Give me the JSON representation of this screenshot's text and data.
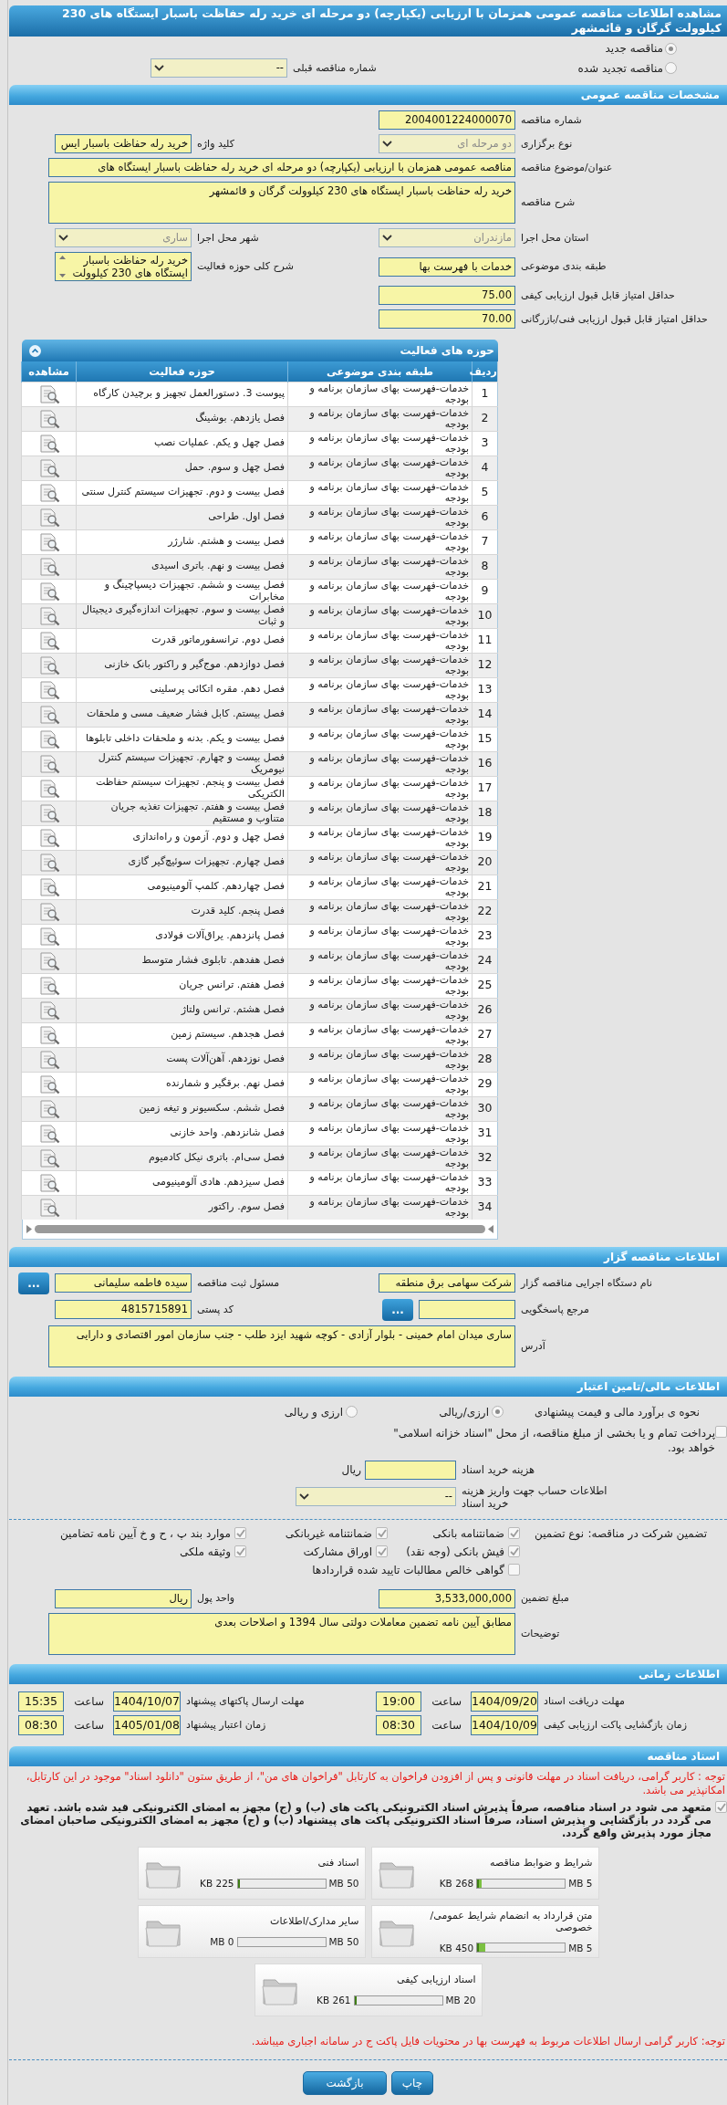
{
  "page_title": "مشاهده اطلاعات مناقصه عمومی همزمان با ارزیابی (یکپارچه) دو مرحله ای خرید رله حفاظت باسبار ایستگاه های 230 کیلوولت گرگان و قائمشهر",
  "tender_type": [
    {
      "label": "مناقصه جدید",
      "selected": true
    },
    {
      "label": "مناقصه تجدید شده",
      "selected": false
    }
  ],
  "previous_tender": {
    "label": "شماره مناقصه قبلی",
    "kind": "select",
    "value": "--",
    "disabled": false
  },
  "general": {
    "title": "مشخصات مناقصه عمومی",
    "rows": [
      [
        {
          "label": "شماره مناقصه",
          "kind": "text",
          "value": "2004001224000070"
        }
      ],
      [
        {
          "label": "نوع برگزاری",
          "kind": "select",
          "value": "دو مرحله ای",
          "disabled": true
        },
        {
          "label": "کلید واژه",
          "kind": "text",
          "value": "خرید رله حفاظت باسبار ایس"
        }
      ],
      [
        {
          "label": "عنوان/موضوع مناقصه",
          "kind": "longtext",
          "value": "مناقصه عمومی همزمان با ارزیابی (یکپارچه) دو مرحله ای خرید رله حفاظت باسبار ایستگاه های"
        }
      ],
      [
        {
          "label": "شرح مناقصه",
          "kind": "textarea",
          "value": "خرید رله حفاظت باسبار ایستگاه های 230 کیلوولت گرگان و قائمشهر"
        }
      ],
      [
        {
          "label": "استان محل اجرا",
          "kind": "select",
          "value": "مازندران",
          "disabled": true
        },
        {
          "label": "شهر محل اجرا",
          "kind": "select",
          "value": "ساری",
          "disabled": true
        }
      ],
      [
        {
          "label": "طبقه بندی موضوعی",
          "kind": "text",
          "value": "خدمات با فهرست بها"
        },
        {
          "label": "شرح کلی حوزه فعالیت",
          "kind": "listbox",
          "value": "خرید رله حفاظت باسبار ایستگاه های 230 کیلوولت"
        }
      ],
      [
        {
          "label": "حداقل امتیاز قابل قبول ارزیابی کیفی",
          "kind": "text",
          "value": "75.00"
        }
      ],
      [
        {
          "label": "حداقل امتیاز قابل قبول ارزیابی فنی/بازرگانی",
          "kind": "text",
          "value": "70.00"
        }
      ]
    ]
  },
  "activity": {
    "title": "حوزه های فعالیت",
    "columns": [
      "ردیف",
      "طبقه بندی موضوعی",
      "حوزه فعالیت",
      "مشاهده"
    ],
    "rows": [
      {
        "number": "1",
        "category": "خدمات-فهرست بهای سازمان برنامه و بودجه",
        "activity": "پیوست 3. دستورالعمل تجهیز و برچیدن کارگاه"
      },
      {
        "number": "2",
        "category": "خدمات-فهرست بهای سازمان برنامه و بودجه",
        "activity": "فصل یازدهم. بوشینگ"
      },
      {
        "number": "3",
        "category": "خدمات-فهرست بهای سازمان برنامه و بودجه",
        "activity": "فصل چهل و یکم. عملیات نصب"
      },
      {
        "number": "4",
        "category": "خدمات-فهرست بهای سازمان برنامه و بودجه",
        "activity": "فصل چهل و سوم. حمل"
      },
      {
        "number": "5",
        "category": "خدمات-فهرست بهای سازمان برنامه و بودجه",
        "activity": "فصل بیست و دوم. تجهیزات سیستم کنترل سنتی"
      },
      {
        "number": "6",
        "category": "خدمات-فهرست بهای سازمان برنامه و بودجه",
        "activity": "فصل اول. طراحی"
      },
      {
        "number": "7",
        "category": "خدمات-فهرست بهای سازمان برنامه و بودجه",
        "activity": "فصل بیست و هشتم. شارژر"
      },
      {
        "number": "8",
        "category": "خدمات-فهرست بهای سازمان برنامه و بودجه",
        "activity": "فصل بیست و نهم. باتری اسیدی"
      },
      {
        "number": "9",
        "category": "خدمات-فهرست بهای سازمان برنامه و بودجه",
        "activity": "فصل بیست و ششم. تجهیزات دیسپاچینگ و مخابرات"
      },
      {
        "number": "10",
        "category": "خدمات-فهرست بهای سازمان برنامه و بودجه",
        "activity": "فصل بیست و سوم. تجهیزات اندازه‌گیری دیجیتال و ثبات"
      },
      {
        "number": "11",
        "category": "خدمات-فهرست بهای سازمان برنامه و بودجه",
        "activity": "فصل دوم. ترانسفورماتور قدرت"
      },
      {
        "number": "12",
        "category": "خدمات-فهرست بهای سازمان برنامه و بودجه",
        "activity": "فصل دوازدهم. موج‌گیر و راکتور بانک خازنی"
      },
      {
        "number": "13",
        "category": "خدمات-فهرست بهای سازمان برنامه و بودجه",
        "activity": "فصل دهم. مقره اتکائی پرسلینی"
      },
      {
        "number": "14",
        "category": "خدمات-فهرست بهای سازمان برنامه و بودجه",
        "activity": "فصل بیستم. کابل فشار ضعیف مسی و ملحقات"
      },
      {
        "number": "15",
        "category": "خدمات-فهرست بهای سازمان برنامه و بودجه",
        "activity": "فصل بیست و یکم. بدنه و ملحقات داخلی تابلوها"
      },
      {
        "number": "16",
        "category": "خدمات-فهرست بهای سازمان برنامه و بودجه",
        "activity": "فصل بیست و چهارم. تجهیزات سیستم کنترل نیومریک"
      },
      {
        "number": "17",
        "category": "خدمات-فهرست بهای سازمان برنامه و بودجه",
        "activity": "فصل بیست و پنجم. تجهیزات سیستم حفاظت الکتریکی"
      },
      {
        "number": "18",
        "category": "خدمات-فهرست بهای سازمان برنامه و بودجه",
        "activity": "فصل بیست و هفتم. تجهیزات تغذیه جریان متناوب و مستقیم"
      },
      {
        "number": "19",
        "category": "خدمات-فهرست بهای سازمان برنامه و بودجه",
        "activity": "فصل چهل و دوم. آزمون و راه‌اندازی"
      },
      {
        "number": "20",
        "category": "خدمات-فهرست بهای سازمان برنامه و بودجه",
        "activity": "فصل چهارم. تجهیزات سوئیچ‌گیر گازی"
      },
      {
        "number": "21",
        "category": "خدمات-فهرست بهای سازمان برنامه و بودجه",
        "activity": "فصل چهاردهم. کلمپ آلومینیومی"
      },
      {
        "number": "22",
        "category": "خدمات-فهرست بهای سازمان برنامه و بودجه",
        "activity": "فصل پنجم. کلید قدرت"
      },
      {
        "number": "23",
        "category": "خدمات-فهرست بهای سازمان برنامه و بودجه",
        "activity": "فصل پانزدهم. یراق‌آلات فولادی"
      },
      {
        "number": "24",
        "category": "خدمات-فهرست بهای سازمان برنامه و بودجه",
        "activity": "فصل هفدهم. تابلوی فشار متوسط"
      },
      {
        "number": "25",
        "category": "خدمات-فهرست بهای سازمان برنامه و بودجه",
        "activity": "فصل هفتم. ترانس جریان"
      },
      {
        "number": "26",
        "category": "خدمات-فهرست بهای سازمان برنامه و بودجه",
        "activity": "فصل هشتم. ترانس ولتاژ"
      },
      {
        "number": "27",
        "category": "خدمات-فهرست بهای سازمان برنامه و بودجه",
        "activity": "فصل هجدهم. سیستم زمین"
      },
      {
        "number": "28",
        "category": "خدمات-فهرست بهای سازمان برنامه و بودجه",
        "activity": "فصل نوزدهم. آهن‌آلات پست"
      },
      {
        "number": "29",
        "category": "خدمات-فهرست بهای سازمان برنامه و بودجه",
        "activity": "فصل نهم. برقگیر و شمارنده"
      },
      {
        "number": "30",
        "category": "خدمات-فهرست بهای سازمان برنامه و بودجه",
        "activity": "فصل ششم. سکسیونر و تیغه زمین"
      },
      {
        "number": "31",
        "category": "خدمات-فهرست بهای سازمان برنامه و بودجه",
        "activity": "فصل شانزدهم. واحد خازنی"
      },
      {
        "number": "32",
        "category": "خدمات-فهرست بهای سازمان برنامه و بودجه",
        "activity": "فصل سی‌ام. باتری نیکل کادمیوم"
      },
      {
        "number": "33",
        "category": "خدمات-فهرست بهای سازمان برنامه و بودجه",
        "activity": "فصل سیزدهم. هادی آلومینیومی"
      },
      {
        "number": "34",
        "category": "خدمات-فهرست بهای سازمان برنامه و بودجه",
        "activity": "فصل سوم. راکتور"
      }
    ]
  },
  "organizer": {
    "title": "اطلاعات مناقصه گزار",
    "rows": [
      [
        {
          "label": "نام دستگاه اجرایی مناقصه گزار",
          "kind": "text",
          "value": "شرکت سهامی برق منطقه"
        },
        {
          "label": "مسئول ثبت مناقصه",
          "kind": "text",
          "value": "سیده فاطمه سلیمانی",
          "button": "..."
        }
      ],
      [
        {
          "label": "مرجع پاسخگویی",
          "kind": "text",
          "button": "..."
        },
        {
          "label": "کد پستی",
          "kind": "text",
          "value": "4815715891"
        }
      ],
      [
        {
          "label": "آدرس",
          "kind": "textarea",
          "value": "ساری میدان امام خمینی - بلوار آزادی - کوچه شهید ایزد طلب - جنب سازمان امور اقتصادی و دارایی"
        }
      ]
    ]
  },
  "financial": {
    "title": "اطلاعات مالی/تامین اعتبار",
    "estimate": {
      "label": "نحوه ی برآورد مالی و قیمت پیشنهادی",
      "options": [
        {
          "label": "ارزی/ریالی",
          "selected": true
        },
        {
          "label": "ارزی و ریالی",
          "selected": false
        }
      ]
    },
    "treasury": {
      "label": "پرداخت تمام و یا بخشی از مبلغ مناقصه، از محل \"اسناد خزانه اسلامی\" خواهد بود.",
      "checked": false
    },
    "doc_cost": {
      "label": "هزینه خرید اسناد",
      "kind": "text",
      "unit": "ریال"
    },
    "account": {
      "label": "اطلاعات حساب جهت واریز هزینه خرید اسناد",
      "kind": "select",
      "value": "--",
      "disabled": false
    },
    "guarantee": {
      "label": "تضمین شرکت در مناقصه:",
      "type_label": "نوع تضمین",
      "options": [
        {
          "label": "ضمانتنامه بانکی",
          "checked": true
        },
        {
          "label": "ضمانتنامه غیربانکی",
          "checked": true
        },
        {
          "label": "موارد بند پ ، ح و خ آیین نامه تضامین",
          "checked": true
        },
        {
          "label": "فیش بانکی (وجه نقد)",
          "checked": true
        },
        {
          "label": "اوراق مشارکت",
          "checked": true
        },
        {
          "label": "وثیقه ملکی",
          "checked": true
        },
        {
          "label": "گواهی خالص مطالبات تایید شده قراردادها",
          "checked": false
        }
      ]
    },
    "rows": [
      [
        {
          "label": "مبلغ تضمین",
          "kind": "text",
          "value": "3,533,000,000"
        },
        {
          "label": "واحد پول",
          "kind": "text",
          "value": "ریال"
        }
      ],
      [
        {
          "label": "توضیحات",
          "kind": "textarea",
          "value": "مطابق آیین نامه تضمین معاملات دولتی سال 1394 و اصلاحات بعدی"
        }
      ]
    ]
  },
  "timing": {
    "title": "اطلاعات زمانی",
    "items": [
      {
        "label": "مهلت دریافت اسناد",
        "date": "1404/09/20",
        "time_label": "ساعت",
        "time": "19:00"
      },
      {
        "label": "مهلت ارسال پاکتهای پیشنهاد",
        "date": "1404/10/07",
        "time_label": "ساعت",
        "time": "15:35"
      },
      {
        "label": "زمان بازگشایی پاکت ارزیابی کیفی",
        "date": "1404/10/09",
        "time_label": "ساعت",
        "time": "08:30"
      },
      {
        "label": "زمان اعتبار پیشنهاد",
        "date": "1405/01/08",
        "time_label": "ساعت",
        "time": "08:30"
      }
    ]
  },
  "documents": {
    "title": "اسناد مناقصه",
    "notice": "توجه : کاربر گرامی، دریافت اسناد در مهلت قانونی و پس از افزودن فراخوان به کارتابل \"فراخوان های من\"، از طریق ستون \"دانلود اسناد\" موجود در این کارتابل، امکانپذیر می باشد.",
    "commitment": {
      "text": "متعهد می شود در اسناد مناقصه، صرفاً پذیرش اسناد الکترونیکی پاکت های (ب) و (ج) مجهز به امضای الکترونیکی قید شده باشد. تعهد می گردد در بازگشایی و پذیرش اسناد، صرفاً اسناد الکترونیکی پاکت های پیشنهاد (ب) و (ج) مجهز به امضای الکترونیکی صاحبان امضای مجاز مورد پذیرش واقع گردد.",
      "checked": true
    },
    "files": [
      {
        "title": "شرایط و ضوابط مناقصه",
        "size": "268 KB",
        "max": "5 MB",
        "level": 0.05
      },
      {
        "title": "اسناد فنی",
        "size": "225 KB",
        "max": "50 MB",
        "level": 0.02
      },
      {
        "title": "متن قرارداد به انضمام شرایط عمومی/خصوصی",
        "size": "450 KB",
        "max": "5 MB",
        "level": 0.09
      },
      {
        "title": "سایر مدارک/اطلاعات",
        "size": "0 MB",
        "max": "50 MB",
        "level": 0
      },
      {
        "title": "اسناد ارزیابی کیفی",
        "size": "261 KB",
        "max": "20 MB",
        "level": 0.02
      }
    ],
    "footnote": "توجه: کاربر گرامی ارسال اطلاعات مربوط به فهرست بها در محتویات فایل پاکت ج در سامانه اجباری میباشد."
  },
  "buttons": [
    {
      "label": "چاپ"
    },
    {
      "label": "بازگشت"
    }
  ]
}
